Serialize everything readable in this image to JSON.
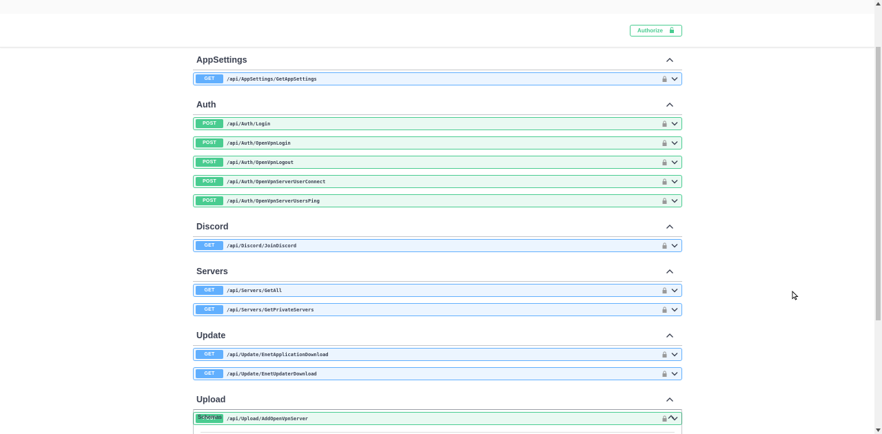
{
  "header": {
    "authorize_label": "Authorize"
  },
  "colors": {
    "get": "#61affe",
    "post": "#49cc90",
    "text": "#3b4151"
  },
  "sections": [
    {
      "title": "AppSettings",
      "ops": [
        {
          "method": "GET",
          "path": "/api/AppSettings/GetAppSettings"
        }
      ]
    },
    {
      "title": "Auth",
      "ops": [
        {
          "method": "POST",
          "path": "/api/Auth/Login"
        },
        {
          "method": "POST",
          "path": "/api/Auth/OpenVpnLogin"
        },
        {
          "method": "POST",
          "path": "/api/Auth/OpenVpnLogout"
        },
        {
          "method": "POST",
          "path": "/api/Auth/OpenVpnServerUserConnect"
        },
        {
          "method": "POST",
          "path": "/api/Auth/OpenVpnServerUsersPing"
        }
      ]
    },
    {
      "title": "Discord",
      "ops": [
        {
          "method": "GET",
          "path": "/api/Discord/JoinDiscord"
        }
      ]
    },
    {
      "title": "Servers",
      "ops": [
        {
          "method": "GET",
          "path": "/api/Servers/GetAll"
        },
        {
          "method": "GET",
          "path": "/api/Servers/GetPrivateServers"
        }
      ]
    },
    {
      "title": "Update",
      "ops": [
        {
          "method": "GET",
          "path": "/api/Update/EnetApplicationDownload"
        },
        {
          "method": "GET",
          "path": "/api/Update/EnetUpdaterDownload"
        }
      ]
    },
    {
      "title": "Upload",
      "ops": [
        {
          "method": "POST",
          "path": "/api/Upload/AddOpenVpnServer"
        }
      ]
    }
  ],
  "schemas": {
    "title": "Schemas"
  }
}
